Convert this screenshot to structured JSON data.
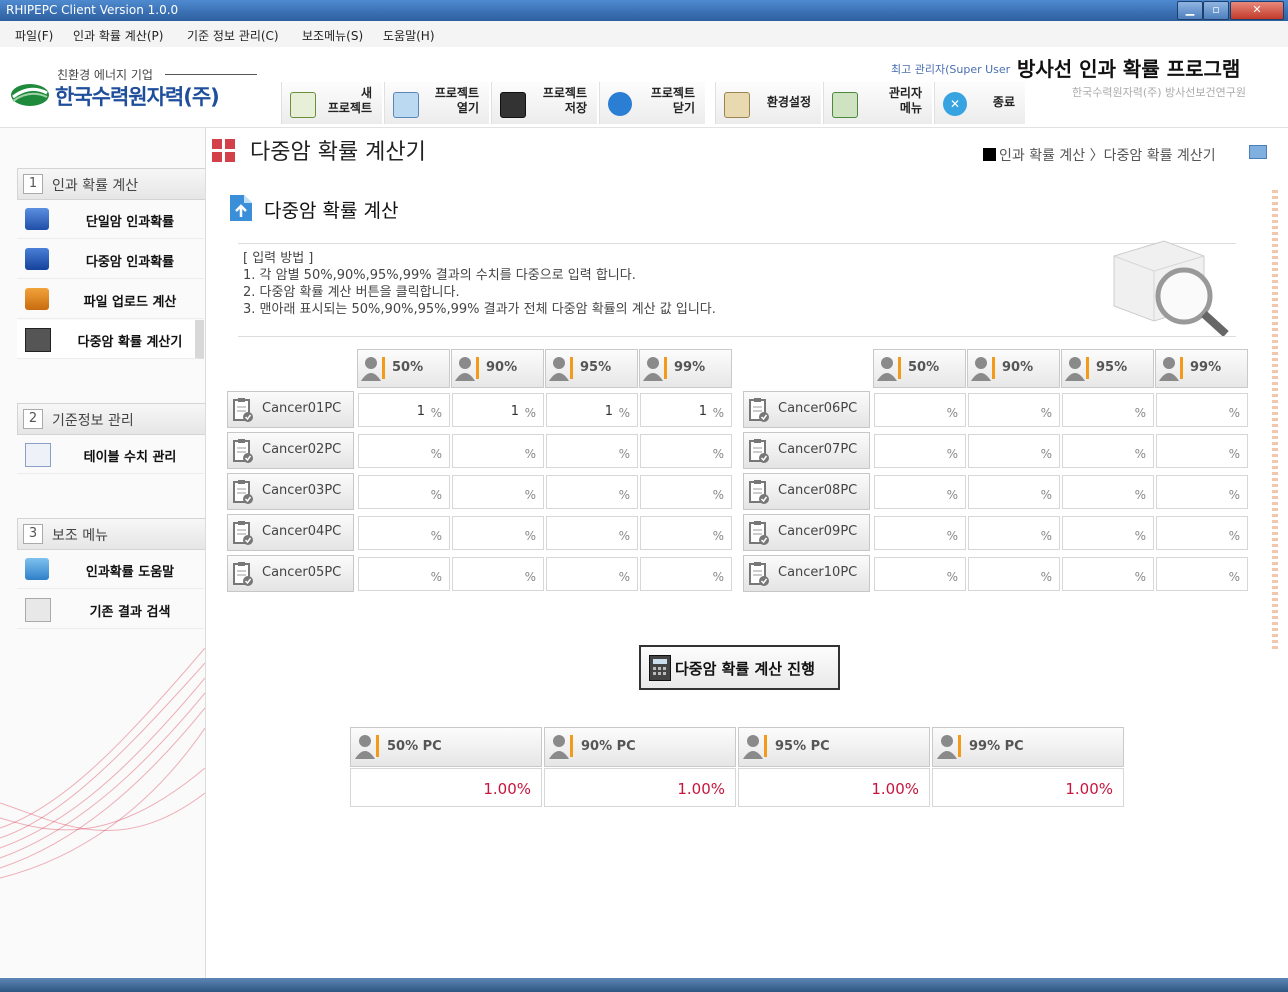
{
  "window": {
    "title": "RHIPEPC Client Version 1.0.0",
    "min": "▁",
    "max": "▫",
    "close": "✕"
  },
  "menu": [
    "파일(F)",
    "인과 확률 계산(P)",
    "기준 정보 관리(C)",
    "보조메뉴(S)",
    "도움말(H)"
  ],
  "header": {
    "slogan": "친환경 에너지 기업",
    "company": "한국수력원자력(주)",
    "user": "최고 관리자(Super User",
    "app_title": "방사선 인과 확률 프로그램",
    "org": "한국수력원자력(주) 방사선보건연구원"
  },
  "toolbar": [
    {
      "icon": "new-project-icon",
      "line1": "새",
      "line2": "프로젝트"
    },
    {
      "icon": "open-project-icon",
      "line1": "프로젝트",
      "line2": "열기"
    },
    {
      "icon": "save-project-icon",
      "line1": "프로젝트",
      "line2": "저장"
    },
    {
      "icon": "close-project-icon",
      "line1": "프로젝트",
      "line2": "닫기"
    },
    {
      "icon": "settings-icon",
      "line1": "환경설정",
      "line2": ""
    },
    {
      "icon": "admin-menu-icon",
      "line1": "관리자",
      "line2": "메뉴"
    },
    {
      "icon": "exit-icon",
      "line1": "종료",
      "line2": ""
    }
  ],
  "sidebar": {
    "sections": [
      {
        "num": "1",
        "title": "인과 확률 계산",
        "items": [
          {
            "label": "단일암 인과확률",
            "icon": "cube-icon"
          },
          {
            "label": "다중암 인과확률",
            "icon": "multi-cube-icon"
          },
          {
            "label": "파일 업로드 계산",
            "icon": "upload-box-icon"
          },
          {
            "label": "다중암 확률 계산기",
            "icon": "calculator-icon"
          }
        ]
      },
      {
        "num": "2",
        "title": "기준정보 관리",
        "items": [
          {
            "label": "테이블 수치 관리",
            "icon": "table-icon"
          }
        ]
      },
      {
        "num": "3",
        "title": "보조 메뉴",
        "items": [
          {
            "label": "인과확률 도움말",
            "icon": "help-cube-icon"
          },
          {
            "label": "기존 결과 검색",
            "icon": "search-doc-icon"
          }
        ]
      }
    ]
  },
  "page": {
    "title": "다중암 확률 계산기",
    "breadcrumb": "인과 확률 계산 〉다중암 확률 계산기",
    "subtitle": "다중암 확률 계산",
    "instructions": [
      "[ 입력 방법 ]",
      "1. 각 암별 50%,90%,95%,99% 결과의 수치를 다중으로 입력 합니다.",
      "2. 다중암 확률 계산 버튼을 클릭합니다.",
      "3. 맨아래 표시되는 50%,90%,95%,99% 결과가 전체 다중암 확률의 계산 값 입니다."
    ]
  },
  "grid": {
    "percent_headers": [
      "50%",
      "90%",
      "95%",
      "99%"
    ],
    "unit": "%",
    "left": [
      {
        "label": "Cancer01PC",
        "values": [
          "1",
          "1",
          "1",
          "1"
        ]
      },
      {
        "label": "Cancer02PC",
        "values": [
          "",
          "",
          "",
          ""
        ]
      },
      {
        "label": "Cancer03PC",
        "values": [
          "",
          "",
          "",
          ""
        ]
      },
      {
        "label": "Cancer04PC",
        "values": [
          "",
          "",
          "",
          ""
        ]
      },
      {
        "label": "Cancer05PC",
        "values": [
          "",
          "",
          "",
          ""
        ]
      }
    ],
    "right": [
      {
        "label": "Cancer06PC",
        "values": [
          "",
          "",
          "",
          ""
        ]
      },
      {
        "label": "Cancer07PC",
        "values": [
          "",
          "",
          "",
          ""
        ]
      },
      {
        "label": "Cancer08PC",
        "values": [
          "",
          "",
          "",
          ""
        ]
      },
      {
        "label": "Cancer09PC",
        "values": [
          "",
          "",
          "",
          ""
        ]
      },
      {
        "label": "Cancer10PC",
        "values": [
          "",
          "",
          "",
          ""
        ]
      }
    ]
  },
  "calc_button": "다중암 확률 계산 진행",
  "results": [
    {
      "label": "50% PC",
      "value": "1.00%"
    },
    {
      "label": "90% PC",
      "value": "1.00%"
    },
    {
      "label": "95% PC",
      "value": "1.00%"
    },
    {
      "label": "99% PC",
      "value": "1.00%"
    }
  ],
  "colors": {
    "accent": "#d3404a",
    "result": "#c8143c",
    "brand_blue": "#1f4e9c"
  }
}
